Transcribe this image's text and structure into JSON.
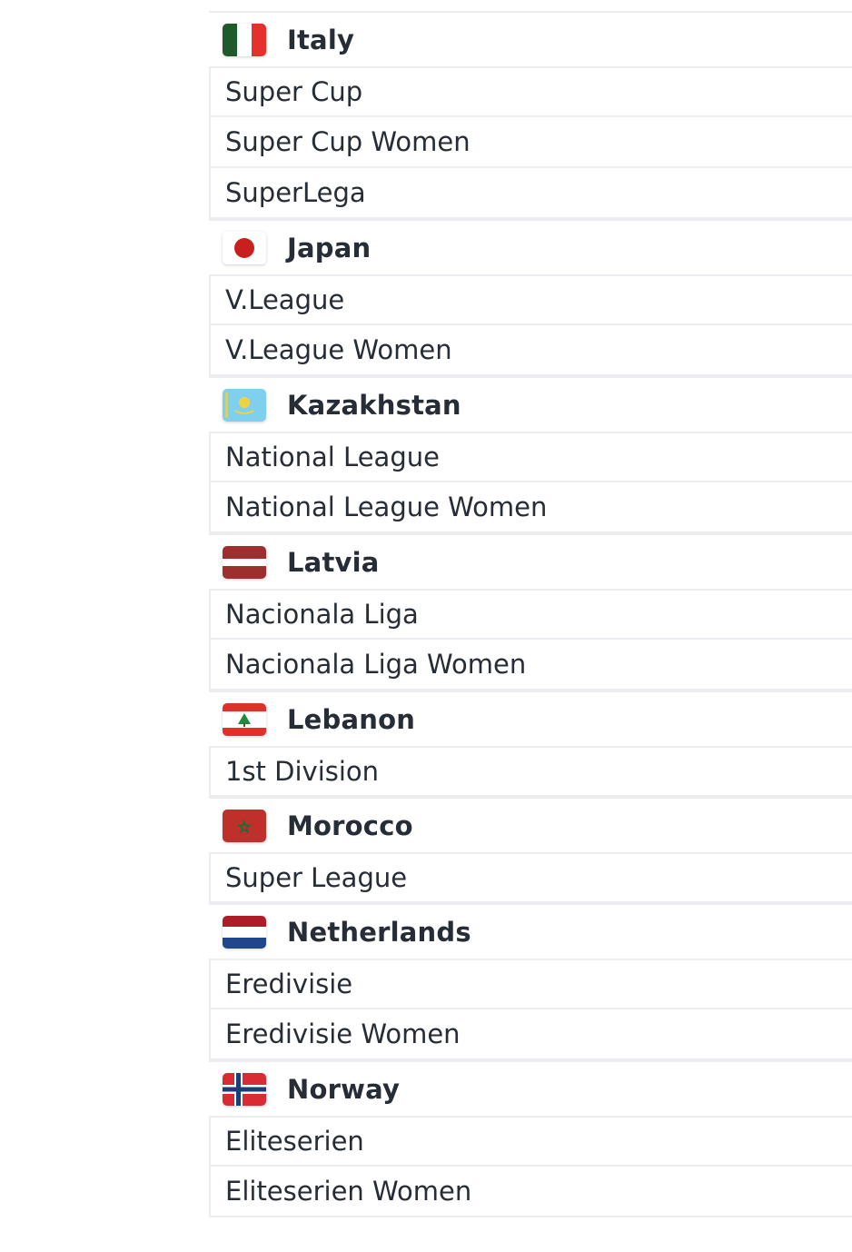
{
  "countries": [
    {
      "name": "Italy",
      "flag": "italy-flag-icon",
      "leagues": [
        "Super Cup",
        "Super Cup Women",
        "SuperLega"
      ]
    },
    {
      "name": "Japan",
      "flag": "japan-flag-icon",
      "leagues": [
        "V.League",
        "V.League Women"
      ]
    },
    {
      "name": "Kazakhstan",
      "flag": "kazakhstan-flag-icon",
      "leagues": [
        "National League",
        "National League Women"
      ]
    },
    {
      "name": "Latvia",
      "flag": "latvia-flag-icon",
      "leagues": [
        "Nacionala Liga",
        "Nacionala Liga Women"
      ]
    },
    {
      "name": "Lebanon",
      "flag": "lebanon-flag-icon",
      "leagues": [
        "1st Division"
      ]
    },
    {
      "name": "Morocco",
      "flag": "morocco-flag-icon",
      "leagues": [
        "Super League"
      ]
    },
    {
      "name": "Netherlands",
      "flag": "netherlands-flag-icon",
      "leagues": [
        "Eredivisie",
        "Eredivisie Women"
      ]
    },
    {
      "name": "Norway",
      "flag": "norway-flag-icon",
      "leagues": [
        "Eliteserien",
        "Eliteserien Women"
      ]
    }
  ],
  "colors": {
    "text": "#262d36",
    "divider": "#ebedf0"
  }
}
